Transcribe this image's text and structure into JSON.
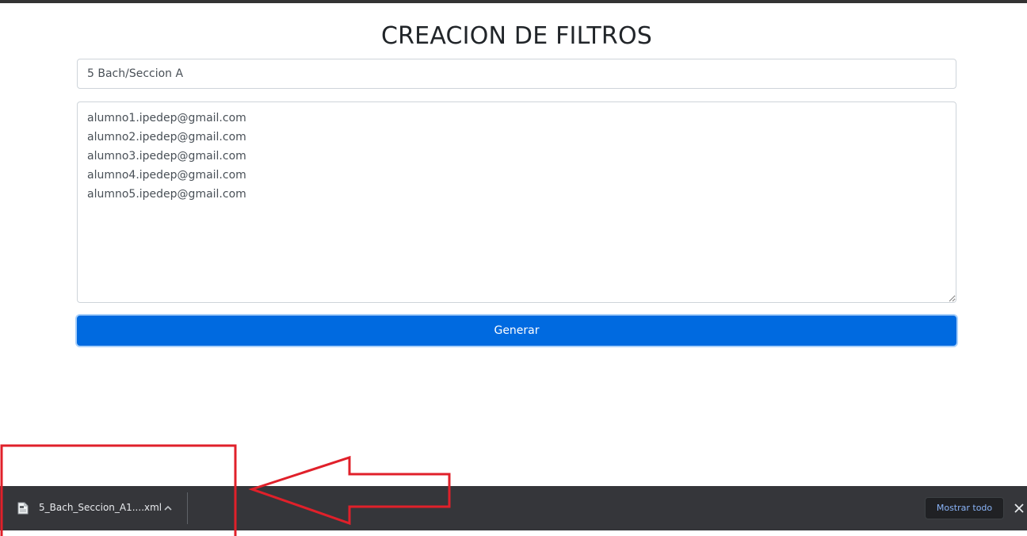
{
  "form": {
    "title": "CREACION DE FILTROS",
    "name_value": "5 Bach/Seccion A",
    "emails": [
      "alumno1.ipedep@gmail.com",
      "alumno2.ipedep@gmail.com",
      "alumno3.ipedep@gmail.com",
      "alumno4.ipedep@gmail.com",
      "alumno5.ipedep@gmail.com"
    ],
    "submit_label": "Generar",
    "button_color": "#006ae0"
  },
  "download_bar": {
    "file_name": "5_Bach_Seccion_A1....xml",
    "file_icon": "file-icon",
    "show_all_label": "Mostrar todo",
    "close_icon": "close-icon",
    "background": "#35363a"
  },
  "annotation": {
    "color": "#e0202a",
    "shapes": [
      "highlight-box",
      "arrow-left"
    ]
  }
}
